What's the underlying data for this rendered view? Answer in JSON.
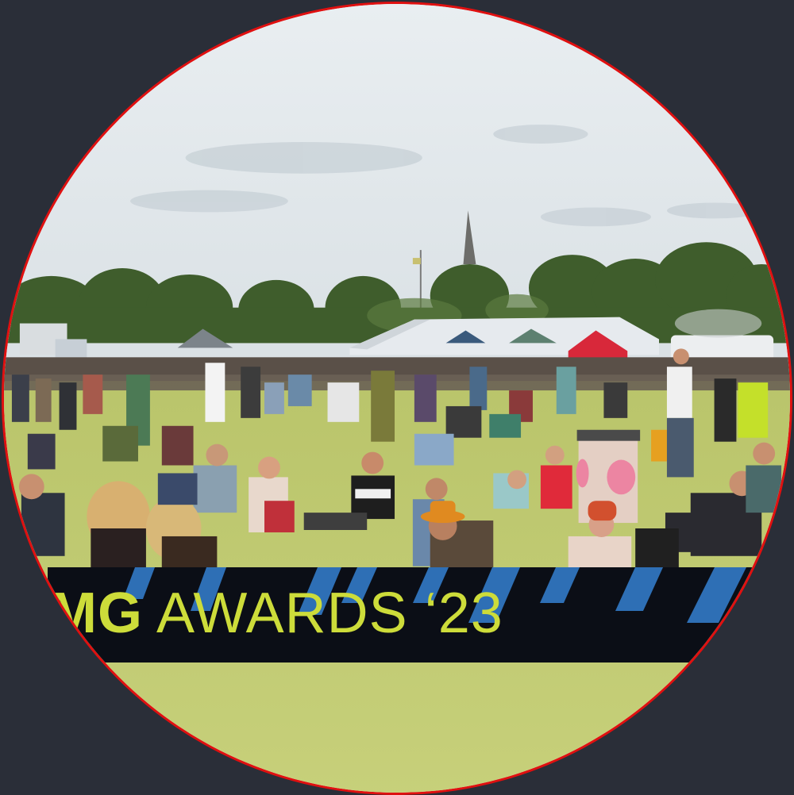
{
  "banner": {
    "title_bold": "MG",
    "title_rest": " AWARDS ‘23"
  },
  "colors": {
    "page_background": "#2a2e38",
    "avatar_ring": "#e01010",
    "banner_background": "#0b0e16",
    "banner_text": "#cddc3a",
    "banner_stripes": "#2e6fb5"
  }
}
